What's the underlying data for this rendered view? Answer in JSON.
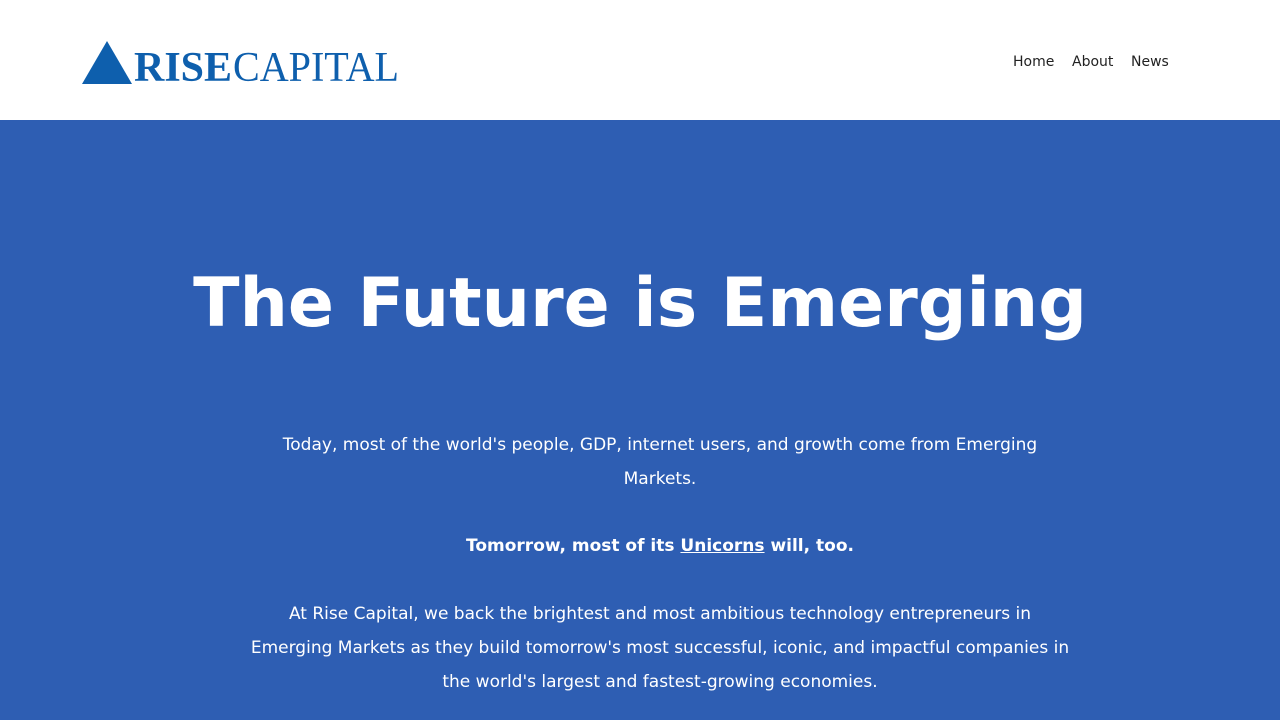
{
  "header": {
    "logo": {
      "word_bold": "RISE",
      "word_regular": "CAPITAL",
      "icon": "triangle-icon",
      "brand_color": "#0e5fad"
    },
    "nav": [
      {
        "label": "Home"
      },
      {
        "label": "About"
      },
      {
        "label": "News"
      }
    ]
  },
  "hero": {
    "background_color": "#2e5eb3",
    "title": "The Future is Emerging",
    "paragraph_1": "Today, most of the world's people, GDP, internet users, and growth come from Emerging Markets.",
    "paragraph_2": {
      "prefix": "Tomorrow, most of its ",
      "link": "Unicorns",
      "suffix": " will, too."
    },
    "paragraph_3": "At Rise Capital, we back the brightest and most ambitious technology entrepreneurs in Emerging Markets as they build tomorrow's most successful, iconic, and impactful companies in the world's largest and fastest-growing economies."
  }
}
